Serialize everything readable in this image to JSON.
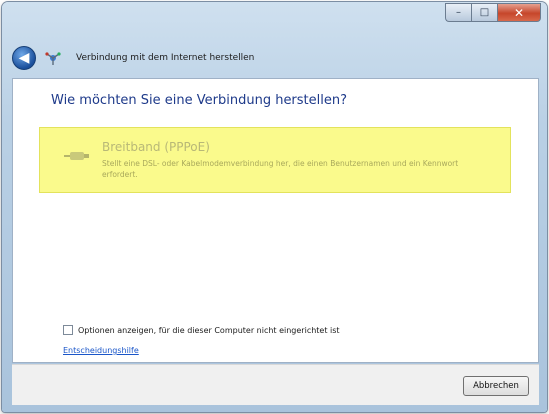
{
  "window": {
    "caption_buttons": {
      "minimize": "–",
      "maximize": "□",
      "close": "✕"
    }
  },
  "nav": {
    "back_icon": "back-arrow-icon",
    "back_glyph": "◀",
    "network_icon": "network-connection-icon",
    "title": "Verbindung mit dem Internet herstellen"
  },
  "main": {
    "heading": "Wie möchten Sie eine Verbindung herstellen?",
    "option": {
      "icon": "broadband-cable-icon",
      "title": "Breitband (PPPoE)",
      "description": "Stellt eine DSL- oder Kabelmodemverbindung her, die einen Benutzernamen und ein Kennwort erfordert."
    },
    "checkbox_label": "Optionen anzeigen, für die dieser Computer nicht eingerichtet ist",
    "checkbox_checked": false,
    "help_link": "Entscheidungshilfe"
  },
  "footer": {
    "cancel_label": "Abbrechen"
  },
  "colors": {
    "highlight": "#fafa8c",
    "heading": "#1e3a8a",
    "link": "#1a56c9"
  }
}
